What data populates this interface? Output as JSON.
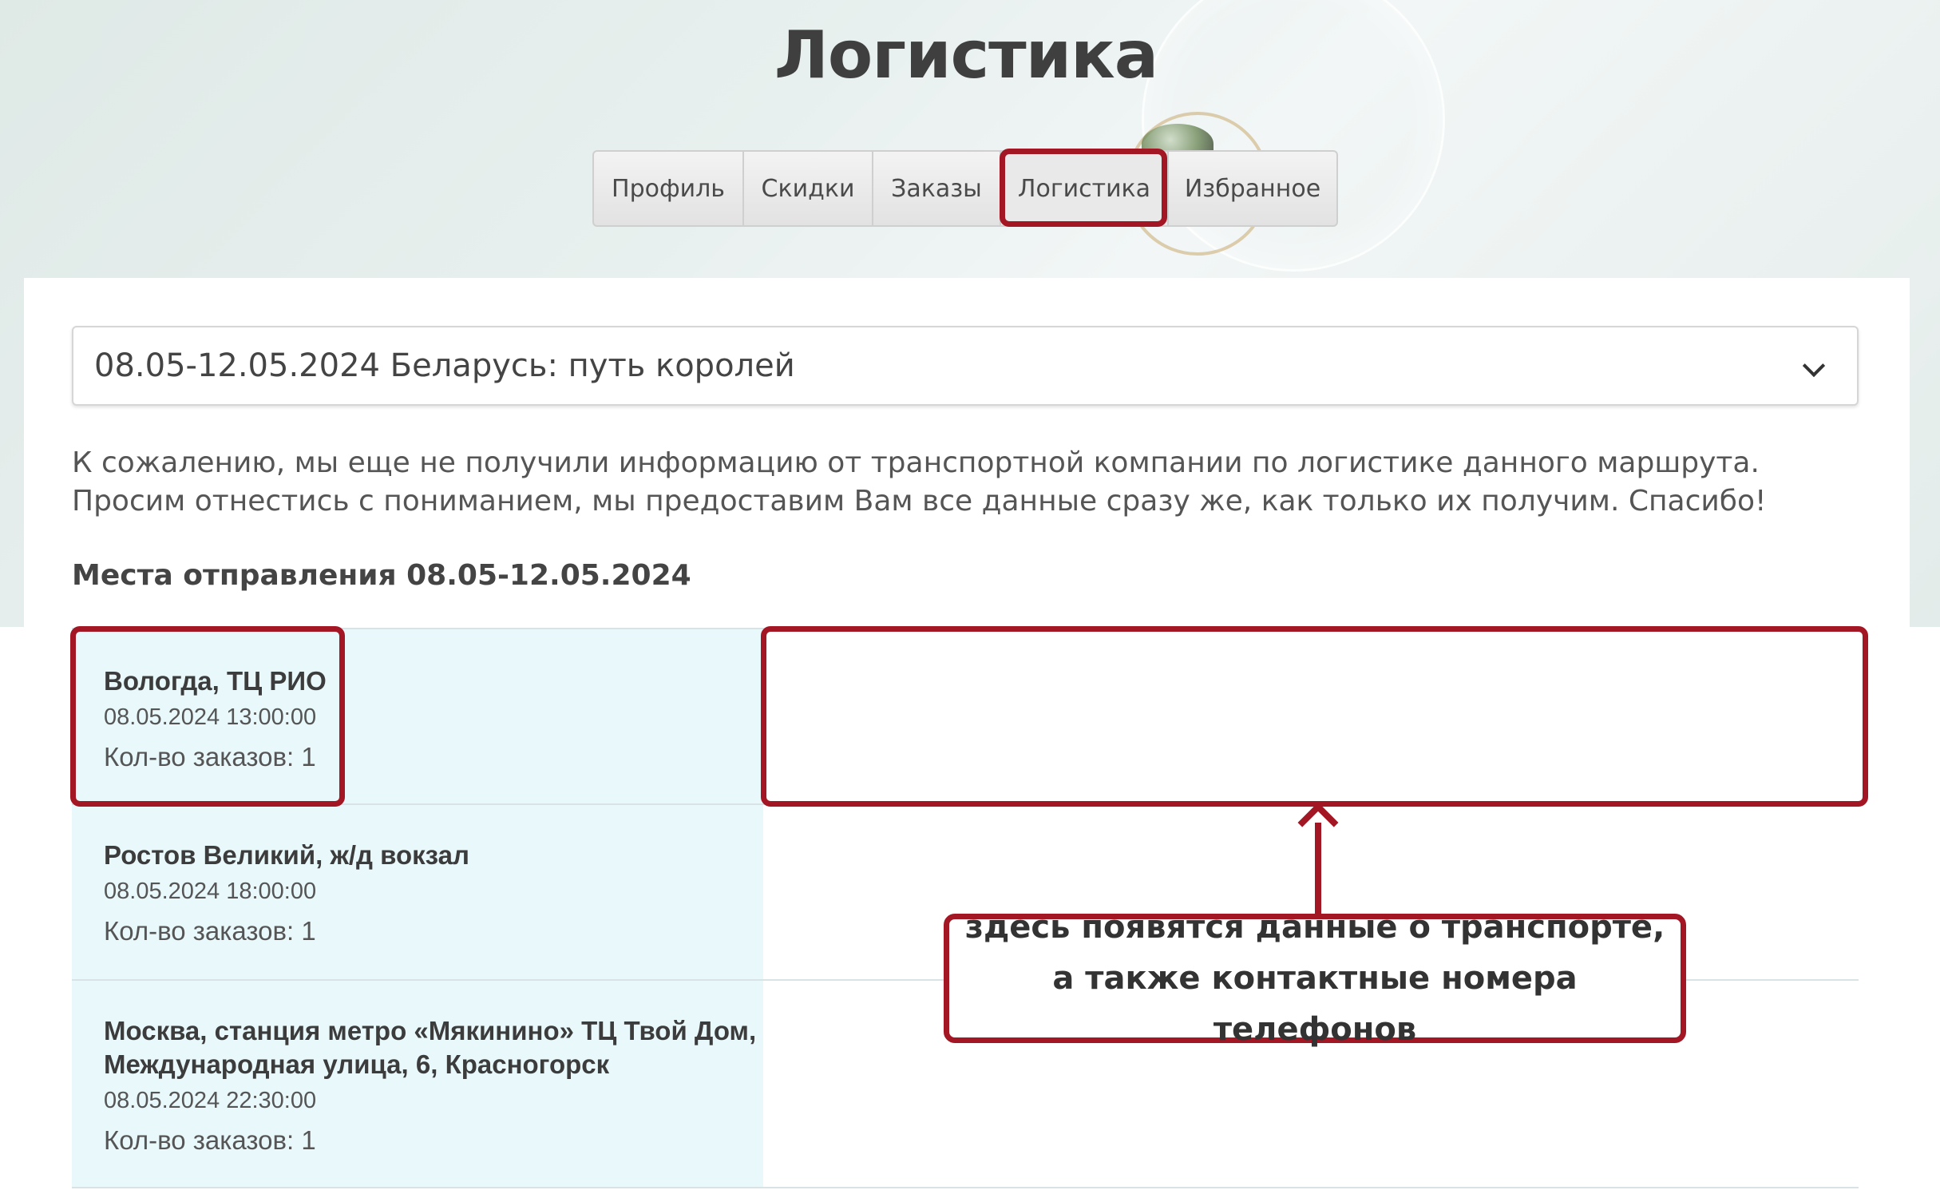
{
  "page": {
    "title": "Логистика"
  },
  "tabs": [
    {
      "label": "Профиль"
    },
    {
      "label": "Скидки"
    },
    {
      "label": "Заказы"
    },
    {
      "label": "Логистика",
      "active": true
    },
    {
      "label": "Избранное"
    }
  ],
  "tour_select": {
    "value": "08.05-12.05.2024 Беларусь: путь королей"
  },
  "notice": "К сожалению, мы еще не получили информацию от транспортной компании по логистике данного маршрута. Просим отнестись с пониманием, мы предоставим Вам все данные сразу же, как только их получим. Спасибо!",
  "departures": {
    "title": "Места отправления 08.05-12.05.2024",
    "items": [
      {
        "name": "Вологда, ТЦ РИО",
        "datetime": "08.05.2024 13:00:00",
        "orders": "Кол-во заказов: 1"
      },
      {
        "name": "Ростов Великий, ж/д вокзал",
        "datetime": "08.05.2024 18:00:00",
        "orders": "Кол-во заказов: 1"
      },
      {
        "name": "Москва, станция метро «Мякинино» ТЦ Твой Дом, Международная улица, 6, Красногорск",
        "datetime": "08.05.2024 22:30:00",
        "orders": "Кол-во заказов: 1"
      }
    ]
  },
  "annotation": {
    "line1": "здесь появятся данные о транспорте,",
    "line2": "а также контактные номера телефонов",
    "color": "#a31624"
  }
}
